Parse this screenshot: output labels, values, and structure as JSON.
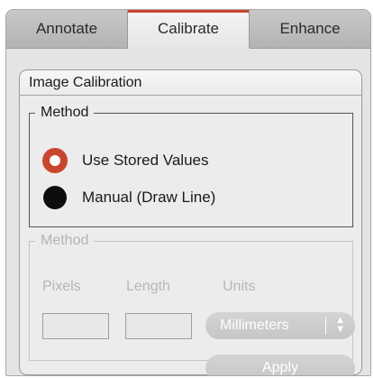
{
  "tabs": [
    {
      "label": "Annotate",
      "active": false
    },
    {
      "label": "Calibrate",
      "active": true
    },
    {
      "label": "Enhance",
      "active": false
    }
  ],
  "panel": {
    "title": "Image Calibration",
    "method_group": {
      "legend": "Method",
      "options": [
        {
          "label": "Use Stored Values",
          "selected": true
        },
        {
          "label": "Manual (Draw Line)",
          "selected": false
        }
      ]
    },
    "manual_group": {
      "legend": "Method",
      "enabled": false,
      "pixels_label": "Pixels",
      "length_label": "Length",
      "units_label": "Units",
      "pixels_value": "",
      "length_value": "",
      "units_selected": "Millimeters",
      "apply_label": "Apply"
    }
  },
  "colors": {
    "accent": "#c9462e",
    "disabled_text": "#b4b4b4"
  }
}
